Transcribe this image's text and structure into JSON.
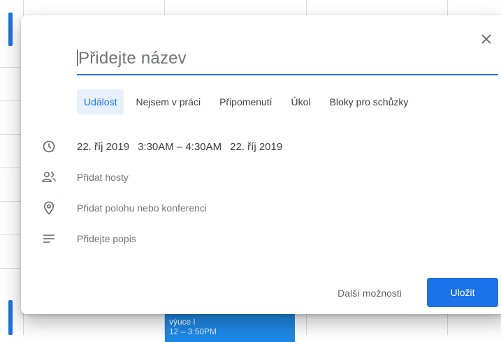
{
  "dialog": {
    "title_placeholder": "Přidejte název",
    "close_icon": "close-icon",
    "tabs": [
      {
        "label": "Událost",
        "active": true
      },
      {
        "label": "Nejsem v práci",
        "active": false
      },
      {
        "label": "Připomenutí",
        "active": false
      },
      {
        "label": "Úkol",
        "active": false
      },
      {
        "label": "Bloky pro schůzky",
        "active": false
      }
    ],
    "datetime": {
      "start_date": "22. říj 2019",
      "time_range": "3:30AM – 4:30AM",
      "end_date": "22. říj 2019"
    },
    "guests_label": "Přidat hosty",
    "location_label": "Přidat polohu nebo konferenci",
    "description_label": "Přidejte popis",
    "more_options_label": "Další možnosti",
    "save_label": "Uložit"
  },
  "background": {
    "event_title": "výuce l",
    "event_time": "12 – 3:50PM"
  },
  "colors": {
    "accent": "#1a73e8",
    "tab_active_bg": "#e8f0fe",
    "event_bg": "#1e88e5"
  }
}
